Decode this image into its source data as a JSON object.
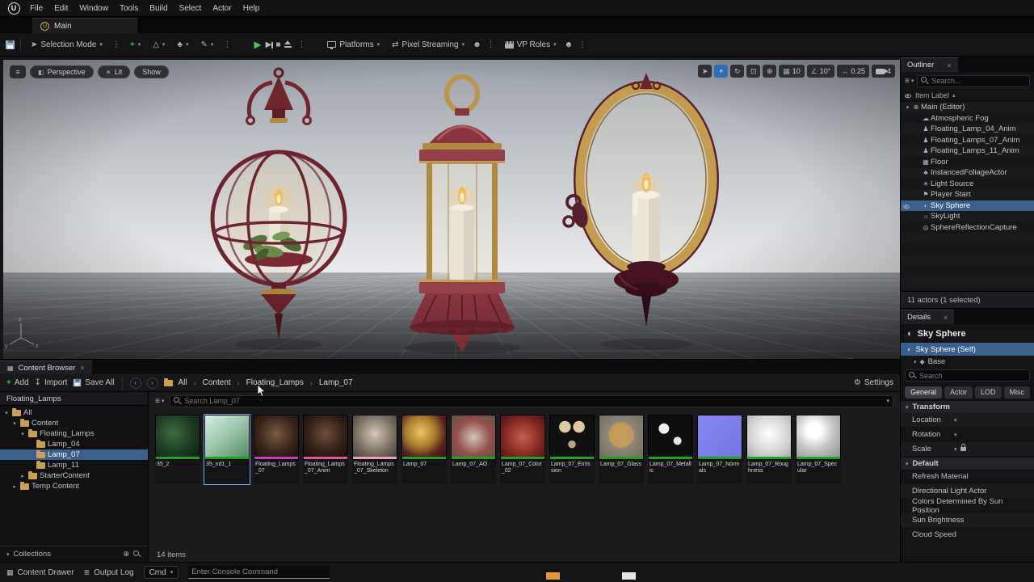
{
  "window": {
    "logo": "U"
  },
  "menubar": {
    "items": [
      "File",
      "Edit",
      "Window",
      "Tools",
      "Build",
      "Select",
      "Actor",
      "Help"
    ]
  },
  "tabs": {
    "main": "Main"
  },
  "icons": {
    "caret": "▾",
    "caret_right": "▸",
    "caret_up": "▴",
    "dots": "⋮",
    "close": "×",
    "crumb_sep": "›",
    "menu": "≡",
    "plus": "+",
    "play": "▶",
    "step": "▶",
    "stop": "■",
    "import": "↧",
    "select": "➤",
    "rotate": "↻",
    "scale_tool": "⊡",
    "world": "⊕",
    "grid": "▦",
    "angle": "∠",
    "scale_snap": "↔",
    "persp": "◧",
    "lit": "☀",
    "people": "☻",
    "stream": "⇄",
    "modes_land": "△",
    "modes_fol": "♣",
    "modes_brush": "✎",
    "gear": "⚙",
    "sphere": "◐",
    "base": "◆",
    "drawer": "▦",
    "log": "≣",
    "collections_add": "⊕"
  },
  "toolbar": {
    "selection_mode": "Selection Mode",
    "platforms": "Platforms",
    "pixel_streaming": "Pixel Streaming",
    "vp_roles": "VP Roles"
  },
  "viewport": {
    "perspective": "Perspective",
    "lit": "Lit",
    "show": "Show",
    "grid_snap": "10",
    "angle_snap": "10°",
    "scale_snap": "0.25",
    "camera_speed": "4"
  },
  "outliner": {
    "title": "Outliner",
    "search_placeholder": "Search...",
    "column_header": "Item Label",
    "rows": [
      {
        "label": "Main (Editor)",
        "icon": "⊕",
        "arrow": "▾",
        "pad": "4px"
      },
      {
        "label": "Atmospheric Fog",
        "icon": "☁",
        "arrow": "",
        "pad": "16px"
      },
      {
        "label": "Floating_Lamp_04_Anim",
        "icon": "♟",
        "arrow": "",
        "pad": "16px"
      },
      {
        "label": "Floating_Lamps_07_Anim",
        "icon": "♟",
        "arrow": "",
        "pad": "16px"
      },
      {
        "label": "Floating_Lamps_11_Anim",
        "icon": "♟",
        "arrow": "",
        "pad": "16px"
      },
      {
        "label": "Floor",
        "icon": "▦",
        "arrow": "",
        "pad": "16px"
      },
      {
        "label": "InstancedFoliageActor",
        "icon": "♣",
        "arrow": "",
        "pad": "16px"
      },
      {
        "label": "Light Source",
        "icon": "☀",
        "arrow": "",
        "pad": "16px"
      },
      {
        "label": "Player Start",
        "icon": "⚑",
        "arrow": "",
        "pad": "16px"
      },
      {
        "label": "Sky Sphere",
        "icon": "◐",
        "arrow": "",
        "pad": "16px",
        "selected": true
      },
      {
        "label": "SkyLight",
        "icon": "☼",
        "arrow": "",
        "pad": "16px"
      },
      {
        "label": "SphereReflectionCapture",
        "icon": "◎",
        "arrow": "",
        "pad": "16px"
      }
    ],
    "status": "11 actors (1 selected)"
  },
  "details": {
    "title": "Details",
    "actor_name": "Sky Sphere",
    "self_label": "Sky Sphere (Self)",
    "base_label": "Base",
    "search_placeholder": "Search",
    "tabs": [
      "General",
      "Actor",
      "LOD",
      "Misc"
    ],
    "transform_title": "Transform",
    "rows": {
      "location": "Location",
      "rotation": "Rotation",
      "scale": "Scale"
    },
    "default_title": "Default",
    "default_rows": [
      "Refresh Material",
      "Directional Light Actor",
      "Colors Determined By Sun Position",
      "Sun Brightness",
      "Cloud Speed"
    ]
  },
  "content_browser": {
    "tab": "Content Browser",
    "add": "Add",
    "import": "Import",
    "save_all": "Save All",
    "breadcrumb": [
      "All",
      "Content",
      "Floating_Lamps",
      "Lamp_07"
    ],
    "settings": "Settings",
    "search_placeholder": "Search Lamp_07",
    "sources_header": "Floating_Lamps",
    "tree": [
      {
        "label": "All",
        "arrow": "▾",
        "pad": "4px"
      },
      {
        "label": "Content",
        "arrow": "▾",
        "pad": "14px"
      },
      {
        "label": "Floating_Lamps",
        "arrow": "▾",
        "pad": "24px"
      },
      {
        "label": "Lamp_04",
        "arrow": "",
        "pad": "34px"
      },
      {
        "label": "Lamp_07",
        "arrow": "",
        "pad": "34px",
        "selected": true
      },
      {
        "label": "Lamp_11",
        "arrow": "",
        "pad": "34px"
      },
      {
        "label": "StarterContent",
        "arrow": "▸",
        "pad": "24px"
      },
      {
        "label": "Temp Content",
        "arrow": "▸",
        "pad": "14px"
      }
    ],
    "collections": "Collections",
    "item_count": "14 items",
    "assets": [
      {
        "name": "35_2",
        "bar": "#1fa21f",
        "thumb": "radial-gradient(circle at 40% 40%, #3f6b40 0%, #1c3a22 55%, #0c1c10 100%)"
      },
      {
        "name": "35_nd1_1",
        "bar": "#1fa21f",
        "selected": true,
        "thumb": "linear-gradient(140deg, #d8ece2 0%, #9fc8ae 45%, #4e8a60 100%)"
      },
      {
        "name": "Floating_Lamps_07",
        "bar": "#c13fc1",
        "thumb": "radial-gradient(circle at 50% 42%, #7a5a42 0%, #3a241a 55%, #17100c 100%)"
      },
      {
        "name": "Floating_Lamps_07_Anim",
        "bar": "#e0569a",
        "thumb": "radial-gradient(circle at 50% 42%, #6e4e3a 0%, #342017 55%, #140e0a 100%)"
      },
      {
        "name": "Floating_Lamps_07_Skeleton",
        "bar": "#eba0c0",
        "thumb": "radial-gradient(circle at 50% 42%, #d2c8b8 0%, #746a5c 60%, #3c372e 100%)"
      },
      {
        "name": "Lamp_07",
        "bar": "#1fa21f",
        "thumb": "radial-gradient(circle at 42% 38%, #ecc468 0%, #a87c2c 40%, #58201c 68%, #320f10 100%)"
      },
      {
        "name": "Lamp_07_AO",
        "bar": "#1fa21f",
        "thumb": "radial-gradient(circle at 50% 50%, #cfc6b8 0%, #96504a 55%, #5c5248 100%)"
      },
      {
        "name": "Lamp_07_Color_02",
        "bar": "#1fa21f",
        "thumb": "radial-gradient(circle at 50% 50%, #c2604e 0%, #8a2a24 55%, #471412 100%)"
      },
      {
        "name": "Lamp_07_Emission",
        "bar": "#1fa21f",
        "thumb": "radial-gradient(circle at 34% 26%, #dccaa6 0%, #dccaa6 13%, rgba(0,0,0,0) 14%), radial-gradient(circle at 66% 26%, #dccaa6 0%, #dccaa6 13%, rgba(0,0,0,0) 14%), radial-gradient(circle at 50% 66%, #baa67e 0%, #baa67e 10%, rgba(0,0,0,0) 11%), #101010"
      },
      {
        "name": "Lamp_07_Glass",
        "bar": "#1fa21f",
        "thumb": "radial-gradient(circle at 50% 45%, #c49a58 0%, #c49a58 36%, #8e8678 42%, #6e685c 100%)"
      },
      {
        "name": "Lamp_07_Metallic",
        "bar": "#1fa21f",
        "thumb": "radial-gradient(circle at 35% 30%, #f2f2f2 0%, #f2f2f2 12%, rgba(0,0,0,0) 13%), radial-gradient(circle at 66% 58%, #e6e6e6 0%, #e6e6e6 10%, rgba(0,0,0,0) 11%), #0d0d0d"
      },
      {
        "name": "Lamp_07_Normals",
        "bar": "#1fa21f",
        "thumb": "linear-gradient(135deg, #8888f2 0%, #7474e2 100%)"
      },
      {
        "name": "Lamp_07_Roughness",
        "bar": "#1fa21f",
        "thumb": "radial-gradient(circle at 50% 42%, #ffffff 0%, #d6d6d6 55%, #a8a8a8 100%)"
      },
      {
        "name": "Lamp_07_Specular",
        "bar": "#1fa21f",
        "thumb": "radial-gradient(circle at 40% 34%, #ffffff 0%, #ffffff 18%, #c4c4c4 50%, #8e8e8e 100%)"
      }
    ]
  },
  "statusbar": {
    "content_drawer": "Content Drawer",
    "output_log": "Output Log",
    "cmd": "Cmd",
    "console_placeholder": "Enter Console Command"
  },
  "colors": {
    "selection_blue": "#3a5f8a",
    "ue_folder_gold": "#c9a052",
    "play_green": "#3fbf4f",
    "type_bar_green": "#1fa21f",
    "skeletal_purple": "#c13fc1"
  }
}
